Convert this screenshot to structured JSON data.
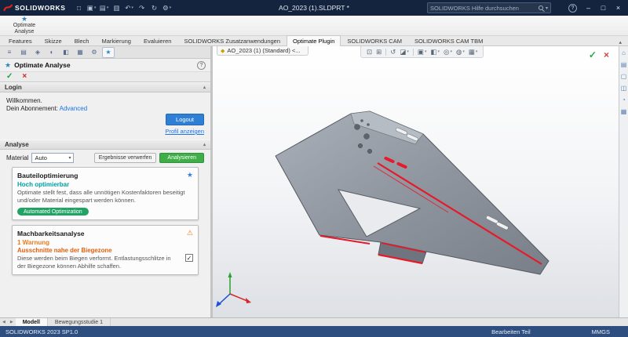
{
  "titlebar": {
    "app_name": "SOLIDWORKS",
    "doc_title": "AO_2023 (1).SLDPRT *",
    "search_placeholder": "SOLIDWORKS Hilfe durchsuchen"
  },
  "ribbon": {
    "button_line1": "Optimate",
    "button_line2": "Analyse"
  },
  "tabs": [
    "Features",
    "Skizze",
    "Blech",
    "Markierung",
    "Evaluieren",
    "SOLIDWORKS Zusatzanwendungen",
    "Optimate Plugin",
    "SOLIDWORKS CAM",
    "SOLIDWORKS CAM TBM"
  ],
  "panel": {
    "title": "Optimate Analyse",
    "login": {
      "heading": "Login",
      "welcome": "Willkommen.",
      "subscription_label": "Dein Abonnement:",
      "subscription_value": "Advanced",
      "logout": "Logout",
      "profile_link": "Profil anzeigen"
    },
    "analyse": {
      "heading": "Analyse",
      "material_label": "Material",
      "material_value": "Auto",
      "discard_button": "Ergebnisse verwerfen",
      "analyze_button": "Analysieren"
    },
    "optimization": {
      "title": "Bauteiloptimierung",
      "status": "Hoch optimierbar",
      "description": "Optimate stellt fest, dass alle unnötigen Kostenfaktoren beseitigt und/oder Material eingespart werden können.",
      "badge": "Automated Optimization"
    },
    "feasibility": {
      "title": "Machbarkeitsanalyse",
      "status": "1 Warnung",
      "warning_title": "Ausschnitte nahe der Biegezone",
      "warning_description": "Diese werden beim Biegen verformt. Entlastungsschlitze in der Biegezone können Abhilfe schaffen.",
      "warning_acknowledged": true
    }
  },
  "viewport": {
    "doc_tab": "AO_2023 (1) (Standard) <..."
  },
  "bottom_tabs": {
    "model": "Modell",
    "motion": "Bewegungsstudie 1"
  },
  "statusbar": {
    "version": "SOLIDWORKS 2023 SP1.0",
    "mode": "Bearbeiten Teil",
    "units": "MMGS"
  },
  "colors": {
    "titlebar_navy": "#15243e",
    "statusbar_blue": "#2d4e7e",
    "bend_highlight_red": "#e51a2b",
    "analyze_green": "#3fae49",
    "badge_green": "#21a366",
    "optimizable_teal": "#00a0a0",
    "warning_orange": "#e87c1e",
    "link_blue": "#1a73e8"
  },
  "icons": {
    "new": "□",
    "open": "▣",
    "save": "▤",
    "print": "▥",
    "undo": "↶",
    "redo": "↷",
    "rebuild": "↻",
    "options": "⚙",
    "help": "?",
    "minimize": "–",
    "maximize": "□",
    "close": "×",
    "check": "✓",
    "cross": "×",
    "optimate": "★",
    "sparkle": "★",
    "warning": "⚠",
    "dropdown": "▾",
    "collapse": "▴",
    "zoom-fit": "⊡",
    "zoom-area": "⊞",
    "previous-view": "↺",
    "section-view": "◪",
    "view-orientation": "▣",
    "display-style": "◧",
    "hide-show": "◎",
    "edit-appearance": "◍",
    "apply-scene": "▦",
    "tab-feature-tree": "≡",
    "tab-property": "▤",
    "tab-configuration": "◈",
    "tab-dimxpert": "◐",
    "tab-display": "◧",
    "tab-cam-feature": "▦",
    "tab-cam-operation": "⚙",
    "tab-optimate": "★",
    "task-home": "⌂",
    "task-design-library": "▤",
    "task-file-explorer": "▢",
    "task-view-palette": "◫",
    "task-appearances": "◔",
    "task-custom-properties": "▦",
    "doc-tab-part": "◆",
    "nav-left": "◀",
    "nav-right": "▶"
  }
}
